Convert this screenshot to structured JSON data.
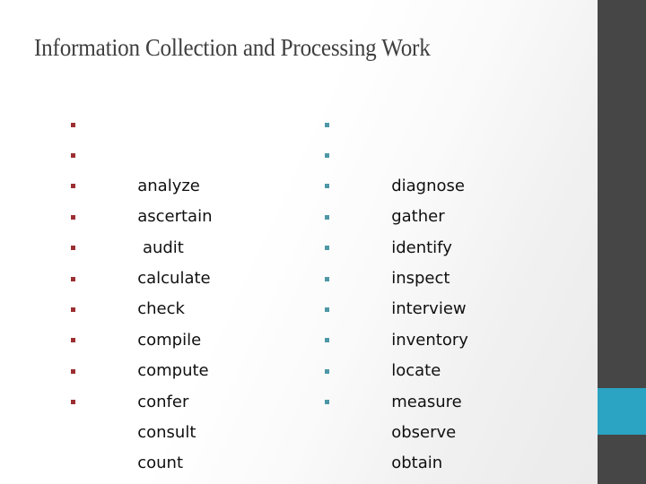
{
  "slide": {
    "title": "Information Collection and Processing Work",
    "background_start": "#ffffff",
    "background_end": "#eaeaea"
  },
  "decoration": {
    "rail_color": "#464646",
    "accent_color": "#2ba3c2"
  },
  "columns": [
    {
      "id": "left",
      "bullet_color": "#9b2f32",
      "items": [
        "analyze",
        "ascertain",
        " audit",
        "calculate",
        "check",
        "compile",
        "compute",
        "confer",
        "consult",
        "count"
      ]
    },
    {
      "id": "right",
      "bullet_color": "#4d97a6",
      "items": [
        "diagnose",
        "gather",
        "identify",
        "inspect",
        "interview",
        "inventory",
        "locate",
        "measure",
        "observe",
        "obtain"
      ]
    }
  ]
}
